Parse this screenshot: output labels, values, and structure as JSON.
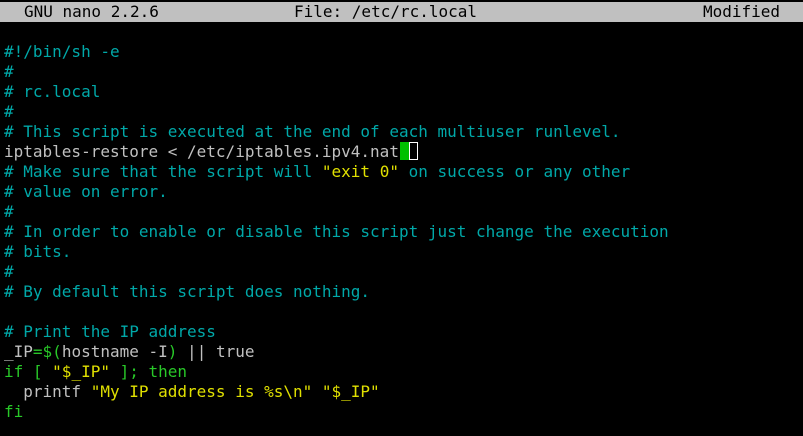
{
  "titlebar": {
    "app": "GNU nano 2.2.6",
    "file": "File: /etc/rc.local",
    "status": "Modified"
  },
  "colors": {
    "background": "#000000",
    "text": "#c0c0c0",
    "comment": "#00a8a8",
    "string": "#e0e000",
    "keyword": "#28c828",
    "cursor": "#00c000",
    "titlebar_bg": "#c0c0c0"
  },
  "editor": {
    "lines": [
      {
        "text": "#!/bin/sh -e",
        "style": "comment"
      },
      {
        "text": "#",
        "style": "comment"
      },
      {
        "text": "# rc.local",
        "style": "comment"
      },
      {
        "text": "#",
        "style": "comment"
      },
      {
        "text": "# This script is executed at the end of each multiuser runlevel.",
        "style": "comment"
      },
      {
        "text": "iptables-restore < /etc/iptables.ipv4.nat",
        "style": "plain"
      },
      {
        "pre": "# Make sure that the script will ",
        "str": "\"exit 0\"",
        "post": " on success or any other",
        "style": "mixed"
      },
      {
        "text": "# value on error.",
        "style": "comment"
      },
      {
        "text": "#",
        "style": "comment"
      },
      {
        "text": "# In order to enable or disable this script just change the execution",
        "style": "comment"
      },
      {
        "text": "# bits.",
        "style": "comment"
      },
      {
        "text": "#",
        "style": "comment"
      },
      {
        "text": "# By default this script does nothing.",
        "style": "comment"
      },
      {
        "text": "",
        "style": "plain"
      },
      {
        "text": "# Print the IP address",
        "style": "comment"
      },
      {
        "a": "_IP",
        "b": "=",
        "c": "$(",
        "d": "hostname -I",
        "e": ")",
        "f": " || true",
        "style": "assign"
      },
      {
        "kw1": "if [ ",
        "str": "\"$_IP\"",
        "kw2": " ]; then",
        "style": "ifline"
      },
      {
        "pre": "  printf ",
        "str": "\"My IP address is %s\\n\" \"$_IP\"",
        "style": "printf"
      },
      {
        "text": "fi",
        "style": "keyword"
      }
    ]
  }
}
